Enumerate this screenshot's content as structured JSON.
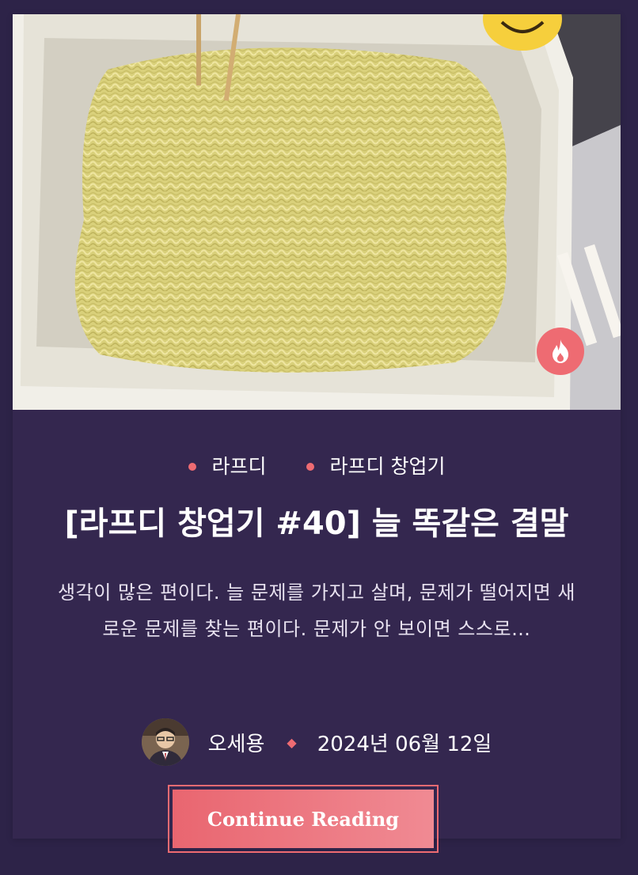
{
  "post": {
    "categories": [
      "라프디",
      "라프디 창업기"
    ],
    "title": "[라프디 창업기 #40] 늘 똑같은 결말",
    "excerpt": "생각이 많은 편이다. 늘 문제를 가지고 살며, 문제가 떨어지면 새로운 문제를 찾는 편이다. 문제가 안 보이면 스스로…",
    "author": "오세용",
    "date": "2024년 06월 12일",
    "cta_label": "Continue Reading",
    "featured_icon": "flame-icon"
  },
  "colors": {
    "accent": "#ee6b72",
    "background": "#2d2348",
    "card": "#34274f"
  }
}
